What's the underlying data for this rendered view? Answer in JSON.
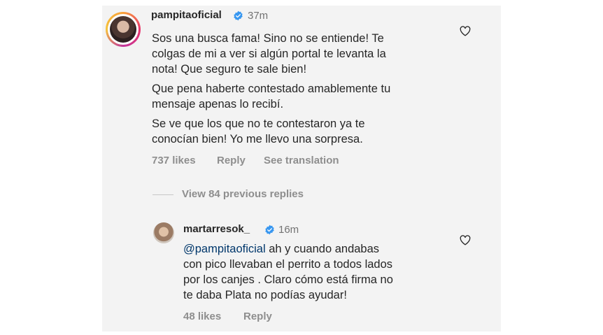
{
  "comment": {
    "username": "pampitaoficial",
    "time": "37m",
    "paragraphs": [
      [
        "Sos una busca fama! Sino no se entiende! Te",
        "colgas de mi a ver si algún portal te levanta la",
        "nota! Que seguro te sale bien!"
      ],
      [
        "Que pena haberte contestado amablemente tu",
        "mensaje apenas lo recibí."
      ],
      [
        "Se ve que los que no te contestaron ya te",
        "conocían bien! Yo me llevo una sorpresa."
      ]
    ],
    "likes": "737 likes",
    "reply_label": "Reply",
    "translation_label": "See translation"
  },
  "view_replies": "View 84 previous replies",
  "reply": {
    "username": "martarresok_",
    "time": "16m",
    "mention": "@pampitaoficial",
    "lines": [
      " ah y cuando andabas",
      "con pico llevaban el perrito a todos lados",
      "por los canjes . Claro cómo está firma no",
      "te daba Plata no podías ayudar!"
    ],
    "likes": "48 likes",
    "reply_label": "Reply"
  },
  "colors": {
    "verified_blue": "#3897f0",
    "mention": "#00376b",
    "muted": "#8e8e8e",
    "panel_bg": "#f3f3f3"
  },
  "icons": [
    "verified-badge-icon",
    "heart-icon"
  ]
}
